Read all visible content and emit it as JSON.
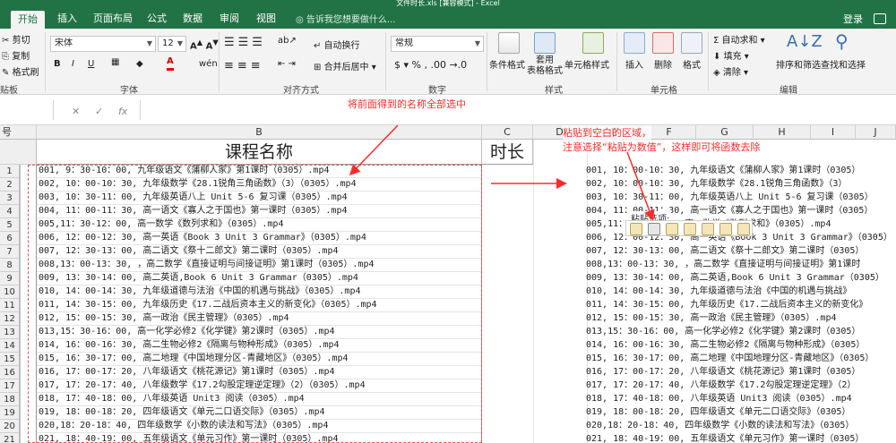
{
  "window": {
    "title": "文件时长.xls [兼容模式] - Excel"
  },
  "tabs": [
    "开始",
    "插入",
    "页面布局",
    "公式",
    "数据",
    "审阅",
    "视图"
  ],
  "tell_me": "告诉我您想要做什么...",
  "account": {
    "login": "登录"
  },
  "ribbon": {
    "clipboard": {
      "cut": "剪切",
      "copy": "复制",
      "painter": "格式刷",
      "label": "贴板"
    },
    "font": {
      "name": "宋体",
      "size": "12",
      "label": "字体"
    },
    "alignment": {
      "wrap": "自动换行",
      "merge": "合并后居中",
      "label": "对齐方式"
    },
    "number": {
      "format": "常规",
      "label": "数字"
    },
    "styles": {
      "conditional": "条件格式",
      "table": "套用\n表格格式",
      "cell": "单元格样式",
      "label": "样式"
    },
    "cells": {
      "insert": "插入",
      "delete": "删除",
      "format": "格式",
      "label": "单元格"
    },
    "editing": {
      "autosum": "自动求和",
      "fill": "填充",
      "clear": "清除",
      "sort": "排序和筛选",
      "find": "查找和选择",
      "label": "编辑"
    }
  },
  "formula_bar": {
    "fx": "fx",
    "cancel": "✕",
    "confirm": "✓"
  },
  "columns": {
    "rownum": "号",
    "b": "B",
    "c": "C",
    "d": "D",
    "e": "E",
    "f": "F",
    "g": "G",
    "h": "H",
    "i": "I",
    "j": "J"
  },
  "headers": {
    "course": "课程名称",
    "duration": "时长"
  },
  "rows": [
    "1",
    "2",
    "3",
    "4",
    "5",
    "6",
    "7",
    "8",
    "9",
    "10",
    "11",
    "12",
    "13",
    "14",
    "15",
    "16",
    "17",
    "18",
    "19",
    "20",
    "21"
  ],
  "courses": [
    "001, 9：30-10：00, 九年级语文《蒲柳人家》第1课时（0305）.mp4",
    "002, 10：00-10：30, 九年级数学《28.1锐角三角函数》（3）（0305）.mp4",
    "003, 10：30-11：00, 九年级英语八上 Unit 5-6 复习课（0305）.mp4",
    "004, 11：00-11：30, 高一语文《寡人之于国也》第一课时（0305）.mp4",
    "005,11：30-12：00, 高一数学《数列求和》（0305）.mp4",
    "006, 12：00-12：30, 高一英语《Book 3 Unit 3 Grammar》（0305）.mp4",
    "007, 12：30-13：00, 高二语文《祭十二郎文》第二课时（0305）.mp4",
    "008,13：00-13：30, ，高二数学《直接证明与间接证明》第1课时（0305）.mp4",
    "009, 13：30-14：00, 高二英语,Book 6 Unit 3 Grammar（0305）.mp4",
    "010, 14：00-14：30, 九年级道德与法治《中国的机遇与挑战》（0305）.mp4",
    "011, 14：30-15：00, 九年级历史《17.二战后资本主义的新变化》（0305）.mp4",
    "012, 15：00-15：30, 高一政治《民主管理》（0305）.mp4",
    "013,15：30-16：00, 高一化学必修2《化学键》第2课时（0305）.mp4",
    "014, 16：00-16：30, 高二生物必修2《隔离与物种形成》（0305）.mp4",
    "015, 16：30-17：00, 高二地理《中国地理分区-青藏地区》（0305）.mp4",
    "016, 17：00-17：20, 八年级语文《桃花源记》第1课时（0305）.mp4",
    "017, 17：20-17：40, 八年级数学《17.2勾股定理逆定理》（2）（0305）.mp4",
    "018, 17：40-18：00, 八年级英语 Unit3 阅读（0305）.mp4",
    "019, 18：00-18：20, 四年级语文《单元二口语交际》（0305）.mp4",
    "020,18：20-18：40, 四年级数学《小数的读法和写法》（0305）.mp4",
    "021, 18：40-19：00, 五年级语文《单元习作》第一课时（0305）.mp4"
  ],
  "pasted": [
    "001, 10：00-10：30, 九年级语文《蒲柳人家》第1课时（0305）",
    "002, 10：00-10：30, 九年级数学《28.1锐角三角函数》（3）",
    "003, 10：30-11：00, 九年级英语八上 Unit 5-6 复习课（0305）",
    "004, 11：00-11：30, 高一语文《寡人之于国也》第一课时（0305）",
    "005,11：30-12：00, 高一数学《数列求和》（0305）.mp4",
    "006, 12：00-12：30, 高一英语《Book 3 Unit 3 Grammar》（0305）",
    "007, 12：30-13：00, 高二语文《祭十二郎文》第二课时（0305）",
    "008,13：00-13：30, ，高二数学《直接证明与间接证明》第1课时",
    "009, 13：30-14：00, 高二英语,Book 6 Unit 3 Grammar（0305）",
    "010, 14：00-14：30, 九年级道德与法治《中国的机遇与挑战》",
    "011, 14：30-15：00, 九年级历史《17.二战后资本主义的新变化》",
    "012, 15：00-15：30, 高一政治《民主管理》（0305）.mp4",
    "013,15：30-16：00, 高一化学必修2《化学键》第2课时（0305）",
    "014, 16：00-16：30, 高二生物必修2《隔离与物种形成》（0305）",
    "015, 16：30-17：00, 高二地理《中国地理分区-青藏地区》（0305）",
    "016, 17：00-17：20, 八年级语文《桃花源记》第1课时（0305）",
    "017, 17：20-17：40, 八年级数学《17.2勾股定理逆定理》（2）",
    "018, 17：40-18：00, 八年级英语 Unit3 阅读（0305）.mp4",
    "019, 18：00-18：20, 四年级语文《单元二口语交际》（0305）",
    "020,18：20-18：40, 四年级数学《小数的读法和写法》（0305）",
    "021, 18：40-19：00, 五年级语文《单元习作》第一课时（0305）"
  ],
  "paste_options": {
    "label": "粘贴选项:"
  },
  "annotations": {
    "select_all": "将前面得到的名称全部选中",
    "paste_blank": "粘贴到空白的区域，",
    "paste_values": "注意选择“粘贴为数值”，这样即可将函数去除"
  },
  "colors": {
    "excel_green": "#217346",
    "annotation_red": "#ff2b2b"
  }
}
